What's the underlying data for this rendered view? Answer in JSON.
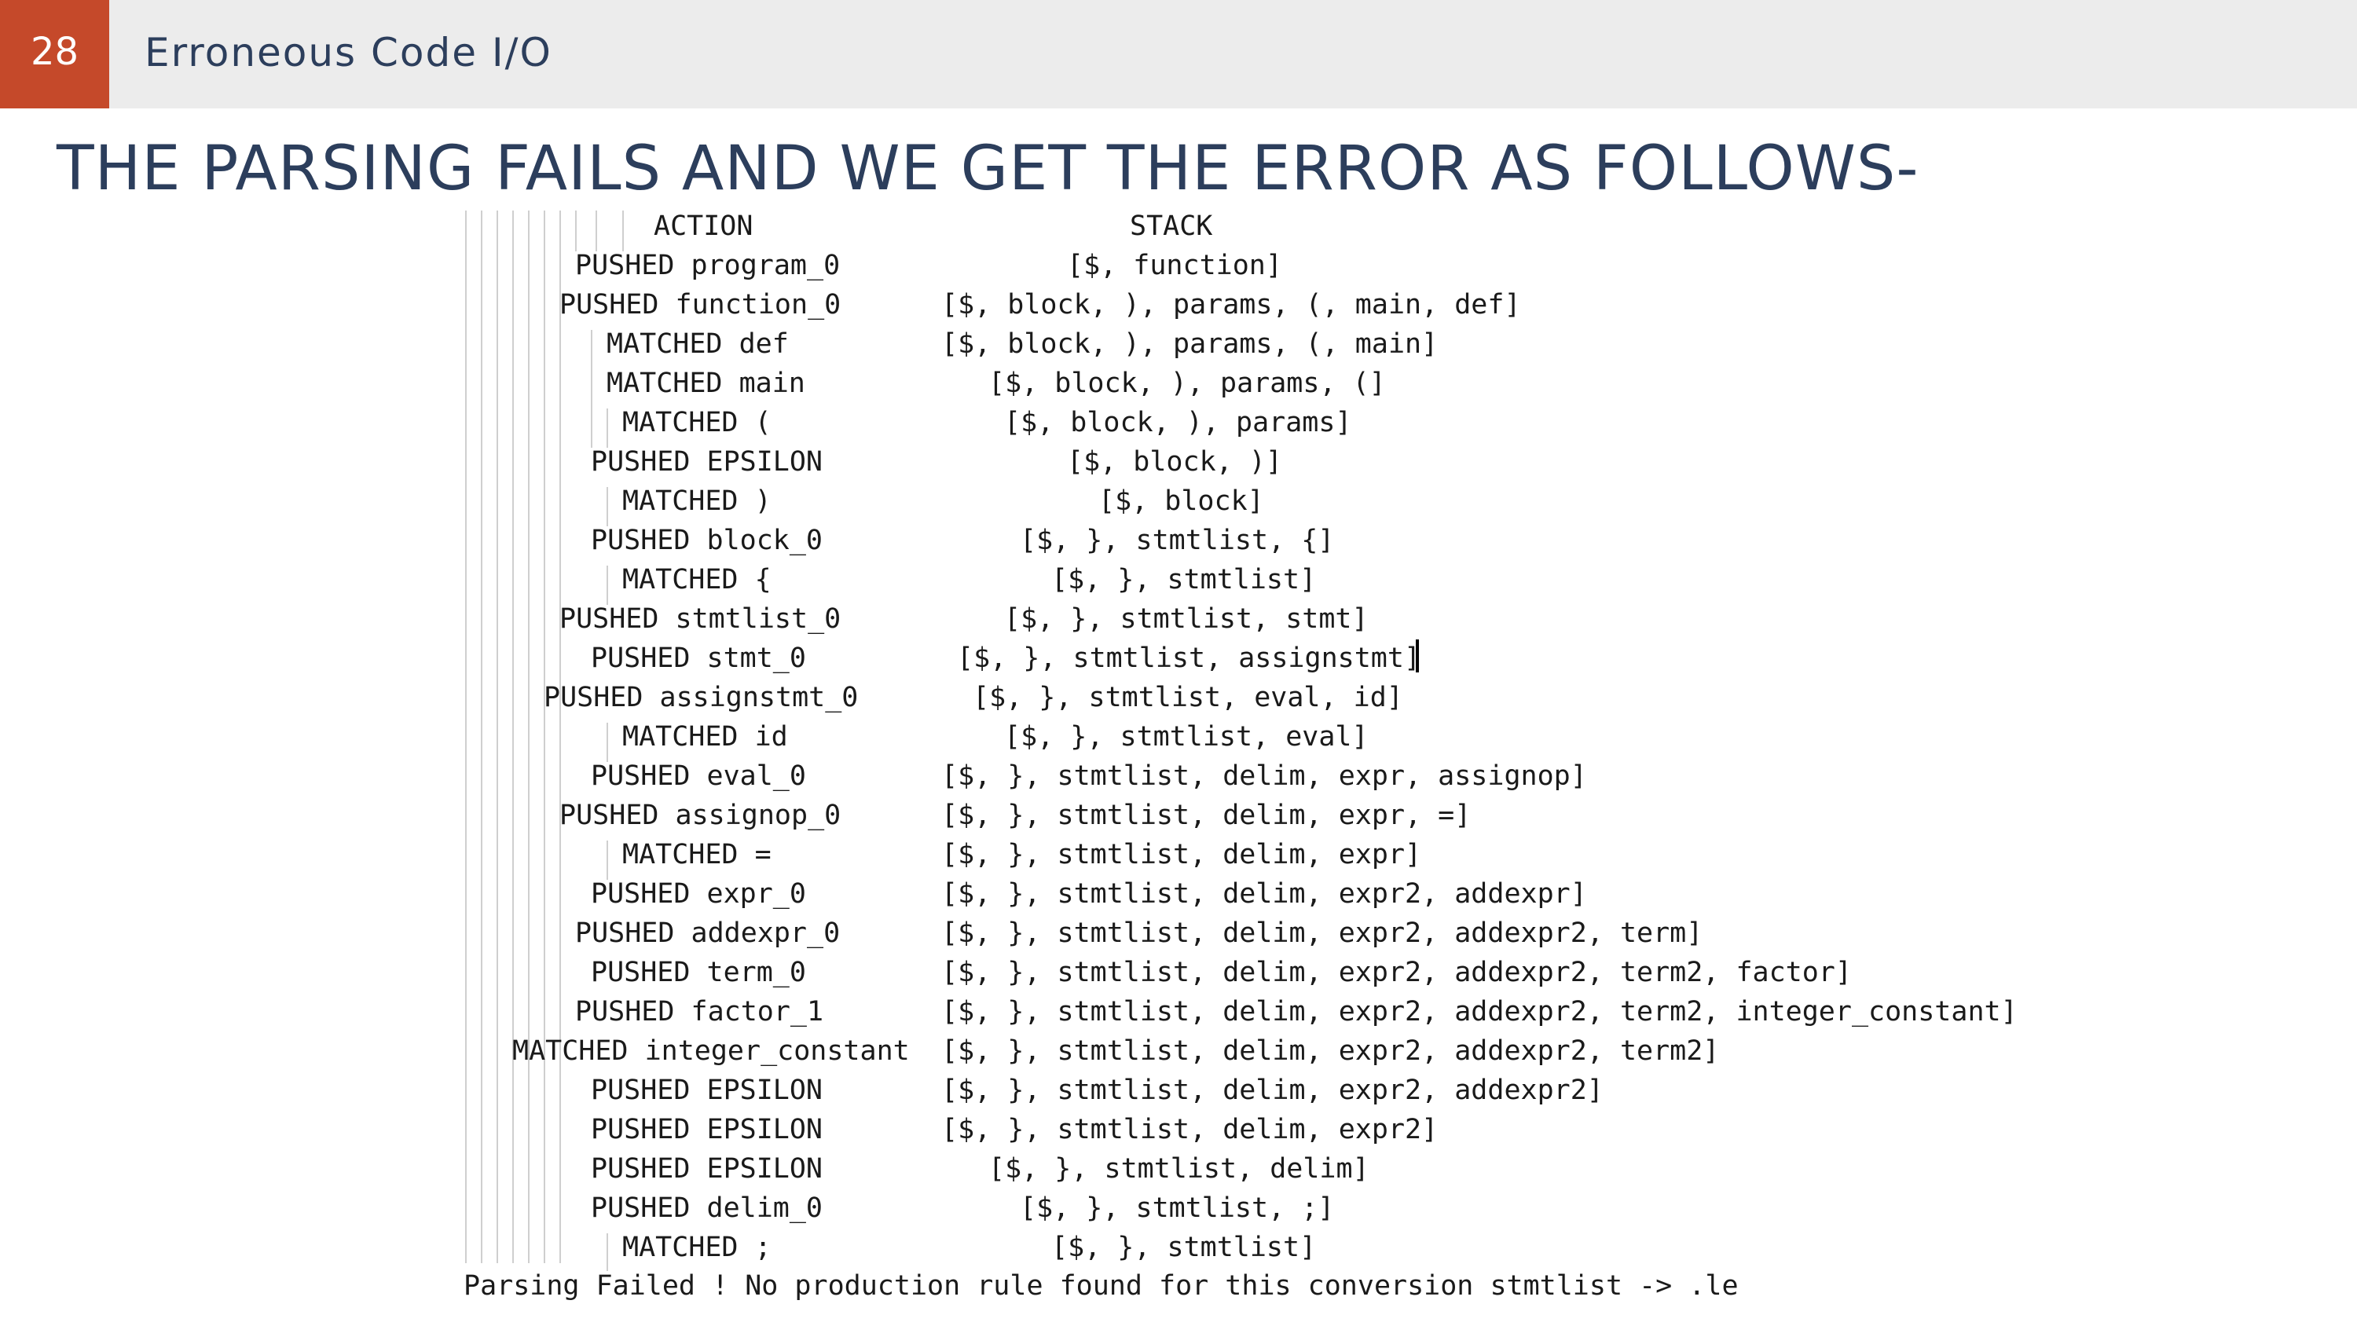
{
  "slide": {
    "number": "28",
    "topic": "Erroneous Code I/O",
    "heading": "THE PARSING FAILS AND WE GET THE ERROR AS FOLLOWS-"
  },
  "trace": {
    "header_action": "ACTION",
    "header_stack": "STACK",
    "rows": [
      {
        "action": "PUSHED program_0",
        "stack": "[$, function]"
      },
      {
        "action": "PUSHED function_0",
        "stack": "[$, block, ), params, (, main, def]"
      },
      {
        "action": "MATCHED def",
        "stack": "[$, block, ), params, (, main]"
      },
      {
        "action": "MATCHED main",
        "stack": "[$, block, ), params, (]"
      },
      {
        "action": "MATCHED (",
        "stack": "[$, block, ), params]"
      },
      {
        "action": "PUSHED EPSILON",
        "stack": "[$, block, )]"
      },
      {
        "action": "MATCHED )",
        "stack": "[$, block]"
      },
      {
        "action": "PUSHED block_0",
        "stack": "[$, }, stmtlist, {]"
      },
      {
        "action": "MATCHED {",
        "stack": "[$, }, stmtlist]"
      },
      {
        "action": "PUSHED stmtlist_0",
        "stack": "[$, }, stmtlist, stmt]"
      },
      {
        "action": "PUSHED stmt_0",
        "stack": "[$, }, stmtlist, assignstmt]"
      },
      {
        "action": "PUSHED assignstmt_0",
        "stack": "[$, }, stmtlist, eval, id]"
      },
      {
        "action": "MATCHED id",
        "stack": "[$, }, stmtlist, eval]"
      },
      {
        "action": "PUSHED eval_0",
        "stack": "[$, }, stmtlist, delim, expr, assignop]"
      },
      {
        "action": "PUSHED assignop_0",
        "stack": "[$, }, stmtlist, delim, expr, =]"
      },
      {
        "action": "MATCHED =",
        "stack": "[$, }, stmtlist, delim, expr]"
      },
      {
        "action": "PUSHED expr_0",
        "stack": "[$, }, stmtlist, delim, expr2, addexpr]"
      },
      {
        "action": "PUSHED addexpr_0",
        "stack": "[$, }, stmtlist, delim, expr2, addexpr2, term]"
      },
      {
        "action": "PUSHED term_0",
        "stack": "[$, }, stmtlist, delim, expr2, addexpr2, term2, factor]"
      },
      {
        "action": "PUSHED factor_1",
        "stack": "[$, }, stmtlist, delim, expr2, addexpr2, term2, integer_constant]"
      },
      {
        "action": "MATCHED integer_constant",
        "stack": "[$, }, stmtlist, delim, expr2, addexpr2, term2]"
      },
      {
        "action": "PUSHED EPSILON",
        "stack": "[$, }, stmtlist, delim, expr2, addexpr2]"
      },
      {
        "action": "PUSHED EPSILON",
        "stack": "[$, }, stmtlist, delim, expr2]"
      },
      {
        "action": "PUSHED EPSILON",
        "stack": "[$, }, stmtlist, delim]"
      },
      {
        "action": "PUSHED delim_0",
        "stack": "[$, }, stmtlist, ;]"
      },
      {
        "action": "MATCHED ;",
        "stack": "[$, }, stmtlist]"
      }
    ],
    "error_message": "Parsing Failed ! No production rule found for this conversion stmtlist -> .le"
  },
  "colors": {
    "accent": "#c5492a",
    "header_bg": "#ececec",
    "title_text": "#2c3e5c"
  }
}
